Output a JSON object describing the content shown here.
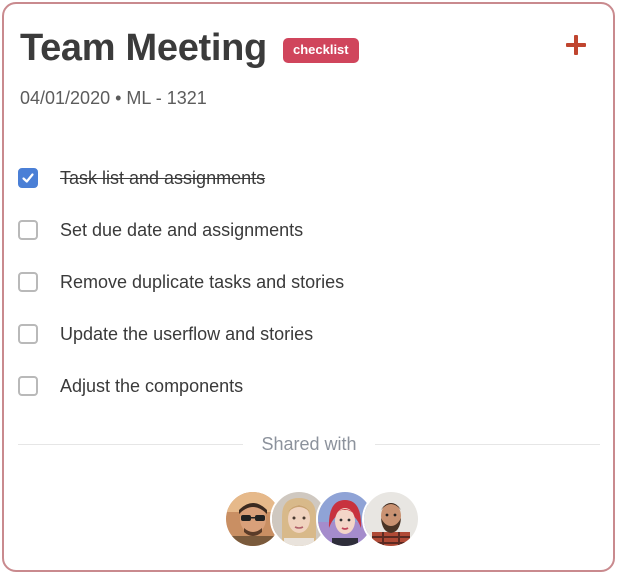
{
  "card": {
    "title": "Team Meeting",
    "badge": "checklist",
    "meta": "04/01/2020 • ML - 1321",
    "add_icon": "plus-icon",
    "accent_color": "#c0452f",
    "badge_color": "#d0455c",
    "check_color": "#4a7fd6"
  },
  "checklist": [
    {
      "label": "Task list and assignments",
      "checked": true
    },
    {
      "label": "Set due date and assignments",
      "checked": false
    },
    {
      "label": "Remove duplicate tasks and stories",
      "checked": false
    },
    {
      "label": "Update the userflow and stories",
      "checked": false
    },
    {
      "label": "Adjust the components",
      "checked": false
    }
  ],
  "shared": {
    "label": "Shared with",
    "avatars": [
      "avatar-icon",
      "avatar-icon",
      "avatar-icon",
      "avatar-icon"
    ]
  }
}
